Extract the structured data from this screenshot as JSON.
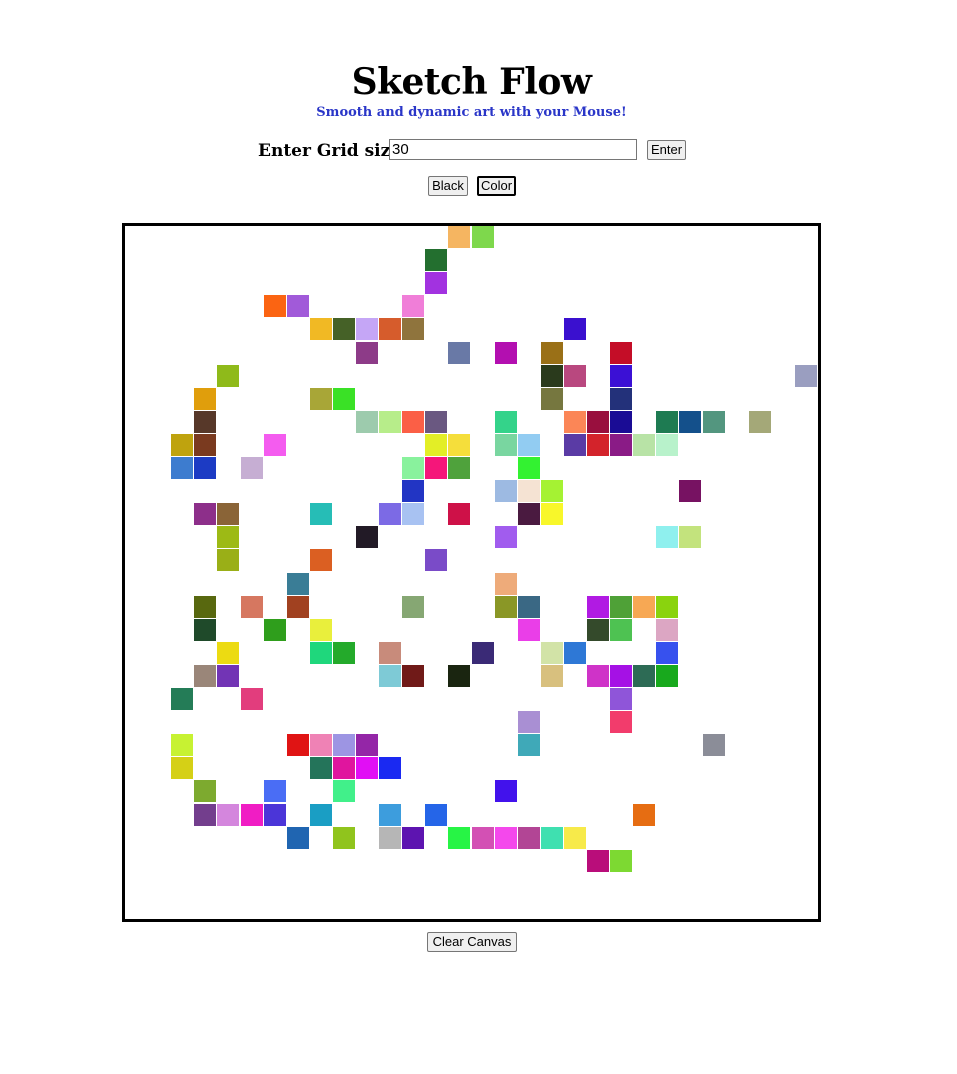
{
  "header": {
    "title": "Sketch Flow",
    "subtitle": "Smooth and dynamic art with your Mouse!"
  },
  "grid_size": {
    "label": "Enter Grid size",
    "value": "30",
    "enter_label": "Enter"
  },
  "mode": {
    "black_label": "Black",
    "color_label": "Color",
    "active": "Color"
  },
  "canvas": {
    "grid_size": 30,
    "background": "#ffffff",
    "painted_cells": [
      {
        "row": 0,
        "col": 14,
        "color": "#f5b561"
      },
      {
        "row": 0,
        "col": 15,
        "color": "#7ed84c"
      },
      {
        "row": 1,
        "col": 13,
        "color": "#236f2f"
      },
      {
        "row": 2,
        "col": 13,
        "color": "#a232e0"
      },
      {
        "row": 3,
        "col": 6,
        "color": "#fb6412"
      },
      {
        "row": 3,
        "col": 7,
        "color": "#a15ad9"
      },
      {
        "row": 3,
        "col": 12,
        "color": "#f07ed8"
      },
      {
        "row": 4,
        "col": 8,
        "color": "#f1b924"
      },
      {
        "row": 4,
        "col": 9,
        "color": "#456127"
      },
      {
        "row": 4,
        "col": 10,
        "color": "#c5a6f6"
      },
      {
        "row": 4,
        "col": 11,
        "color": "#d65c2c"
      },
      {
        "row": 4,
        "col": 12,
        "color": "#8f743d"
      },
      {
        "row": 4,
        "col": 19,
        "color": "#3a10cf"
      },
      {
        "row": 5,
        "col": 10,
        "color": "#8d3b88"
      },
      {
        "row": 5,
        "col": 14,
        "color": "#6979a6"
      },
      {
        "row": 5,
        "col": 16,
        "color": "#b30fb0"
      },
      {
        "row": 5,
        "col": 18,
        "color": "#9a7017"
      },
      {
        "row": 5,
        "col": 21,
        "color": "#c40d27"
      },
      {
        "row": 6,
        "col": 4,
        "color": "#8fba1a"
      },
      {
        "row": 6,
        "col": 18,
        "color": "#2a3a1c"
      },
      {
        "row": 6,
        "col": 19,
        "color": "#b9487f"
      },
      {
        "row": 6,
        "col": 21,
        "color": "#3b10d5"
      },
      {
        "row": 6,
        "col": 29,
        "color": "#9a9ec0"
      },
      {
        "row": 7,
        "col": 3,
        "color": "#e09e0c"
      },
      {
        "row": 7,
        "col": 8,
        "color": "#a8a637"
      },
      {
        "row": 7,
        "col": 9,
        "color": "#3ae126"
      },
      {
        "row": 7,
        "col": 18,
        "color": "#76773f"
      },
      {
        "row": 7,
        "col": 21,
        "color": "#23317a"
      },
      {
        "row": 8,
        "col": 3,
        "color": "#573829"
      },
      {
        "row": 8,
        "col": 10,
        "color": "#9dcbad"
      },
      {
        "row": 8,
        "col": 11,
        "color": "#b7ed8a"
      },
      {
        "row": 8,
        "col": 12,
        "color": "#fb5f46"
      },
      {
        "row": 8,
        "col": 13,
        "color": "#6a5881"
      },
      {
        "row": 8,
        "col": 16,
        "color": "#34d38a"
      },
      {
        "row": 8,
        "col": 19,
        "color": "#fb8657"
      },
      {
        "row": 8,
        "col": 20,
        "color": "#990f3e"
      },
      {
        "row": 8,
        "col": 21,
        "color": "#1a0c95"
      },
      {
        "row": 8,
        "col": 23,
        "color": "#1e7b52"
      },
      {
        "row": 8,
        "col": 24,
        "color": "#14508b"
      },
      {
        "row": 8,
        "col": 25,
        "color": "#53967f"
      },
      {
        "row": 8,
        "col": 27,
        "color": "#a4a878"
      },
      {
        "row": 9,
        "col": 2,
        "color": "#bfa30e"
      },
      {
        "row": 9,
        "col": 3,
        "color": "#7a3a1f"
      },
      {
        "row": 9,
        "col": 6,
        "color": "#f45cef"
      },
      {
        "row": 9,
        "col": 13,
        "color": "#e3ee26"
      },
      {
        "row": 9,
        "col": 14,
        "color": "#f5de3b"
      },
      {
        "row": 9,
        "col": 16,
        "color": "#79d6a0"
      },
      {
        "row": 9,
        "col": 17,
        "color": "#92ccf2"
      },
      {
        "row": 9,
        "col": 19,
        "color": "#5a3ba5"
      },
      {
        "row": 9,
        "col": 20,
        "color": "#d3232b"
      },
      {
        "row": 9,
        "col": 21,
        "color": "#8a1b86"
      },
      {
        "row": 9,
        "col": 22,
        "color": "#b8e3a6"
      },
      {
        "row": 9,
        "col": 23,
        "color": "#b8f2cb"
      },
      {
        "row": 10,
        "col": 2,
        "color": "#3d7ccf"
      },
      {
        "row": 10,
        "col": 3,
        "color": "#1c3bc4"
      },
      {
        "row": 10,
        "col": 5,
        "color": "#c6aed3"
      },
      {
        "row": 10,
        "col": 12,
        "color": "#89f29d"
      },
      {
        "row": 10,
        "col": 13,
        "color": "#f5167a"
      },
      {
        "row": 10,
        "col": 14,
        "color": "#4fa23c"
      },
      {
        "row": 10,
        "col": 17,
        "color": "#33f231"
      },
      {
        "row": 11,
        "col": 12,
        "color": "#2235c4"
      },
      {
        "row": 11,
        "col": 16,
        "color": "#9dbae2"
      },
      {
        "row": 11,
        "col": 17,
        "color": "#f5e3d3"
      },
      {
        "row": 11,
        "col": 18,
        "color": "#a5f233"
      },
      {
        "row": 11,
        "col": 24,
        "color": "#771262"
      },
      {
        "row": 12,
        "col": 3,
        "color": "#8d2f8a"
      },
      {
        "row": 12,
        "col": 4,
        "color": "#8a6437"
      },
      {
        "row": 12,
        "col": 8,
        "color": "#26bdb6"
      },
      {
        "row": 12,
        "col": 11,
        "color": "#7c6ae5"
      },
      {
        "row": 12,
        "col": 12,
        "color": "#a8c2f2"
      },
      {
        "row": 12,
        "col": 14,
        "color": "#ce1148"
      },
      {
        "row": 12,
        "col": 17,
        "color": "#4a1a40"
      },
      {
        "row": 12,
        "col": 18,
        "color": "#f8f72a"
      },
      {
        "row": 13,
        "col": 4,
        "color": "#9dba15"
      },
      {
        "row": 13,
        "col": 10,
        "color": "#221a26"
      },
      {
        "row": 13,
        "col": 16,
        "color": "#a15cee"
      },
      {
        "row": 13,
        "col": 23,
        "color": "#8ff0ee"
      },
      {
        "row": 13,
        "col": 24,
        "color": "#c3e37d"
      },
      {
        "row": 14,
        "col": 4,
        "color": "#9aaf17"
      },
      {
        "row": 14,
        "col": 8,
        "color": "#db5f22"
      },
      {
        "row": 14,
        "col": 13,
        "color": "#7a4bc8"
      },
      {
        "row": 15,
        "col": 7,
        "color": "#3a7d96"
      },
      {
        "row": 15,
        "col": 16,
        "color": "#eeab7a"
      },
      {
        "row": 16,
        "col": 3,
        "color": "#58680f"
      },
      {
        "row": 16,
        "col": 5,
        "color": "#d67760"
      },
      {
        "row": 16,
        "col": 7,
        "color": "#a14120"
      },
      {
        "row": 16,
        "col": 12,
        "color": "#86a773"
      },
      {
        "row": 16,
        "col": 16,
        "color": "#8a9726"
      },
      {
        "row": 16,
        "col": 17,
        "color": "#3a6884"
      },
      {
        "row": 16,
        "col": 20,
        "color": "#b11ae3"
      },
      {
        "row": 16,
        "col": 21,
        "color": "#4fa137"
      },
      {
        "row": 16,
        "col": 22,
        "color": "#f7a854"
      },
      {
        "row": 16,
        "col": 23,
        "color": "#8ad30e"
      },
      {
        "row": 17,
        "col": 3,
        "color": "#1f4a2a"
      },
      {
        "row": 17,
        "col": 6,
        "color": "#2f9e1c"
      },
      {
        "row": 17,
        "col": 8,
        "color": "#e9ef3c"
      },
      {
        "row": 17,
        "col": 17,
        "color": "#ea3ee8"
      },
      {
        "row": 17,
        "col": 20,
        "color": "#344a2b"
      },
      {
        "row": 17,
        "col": 21,
        "color": "#4ec252"
      },
      {
        "row": 17,
        "col": 23,
        "color": "#dca6c3"
      },
      {
        "row": 18,
        "col": 4,
        "color": "#ecdb12"
      },
      {
        "row": 18,
        "col": 8,
        "color": "#1fd77c"
      },
      {
        "row": 18,
        "col": 9,
        "color": "#24aa2b"
      },
      {
        "row": 18,
        "col": 11,
        "color": "#c88b7b"
      },
      {
        "row": 18,
        "col": 15,
        "color": "#3a2a76"
      },
      {
        "row": 18,
        "col": 18,
        "color": "#d2e3a7"
      },
      {
        "row": 18,
        "col": 19,
        "color": "#2e78d6"
      },
      {
        "row": 18,
        "col": 23,
        "color": "#3751ee"
      },
      {
        "row": 19,
        "col": 3,
        "color": "#9a8679"
      },
      {
        "row": 19,
        "col": 4,
        "color": "#7234b5"
      },
      {
        "row": 19,
        "col": 11,
        "color": "#7ecad6"
      },
      {
        "row": 19,
        "col": 12,
        "color": "#701a18"
      },
      {
        "row": 19,
        "col": 14,
        "color": "#1a2510"
      },
      {
        "row": 19,
        "col": 18,
        "color": "#d8c07e"
      },
      {
        "row": 19,
        "col": 20,
        "color": "#cf33c8"
      },
      {
        "row": 19,
        "col": 21,
        "color": "#a511e5"
      },
      {
        "row": 19,
        "col": 22,
        "color": "#2d6b55"
      },
      {
        "row": 19,
        "col": 23,
        "color": "#18a91d"
      },
      {
        "row": 20,
        "col": 2,
        "color": "#247c57"
      },
      {
        "row": 20,
        "col": 5,
        "color": "#e23d7d"
      },
      {
        "row": 20,
        "col": 21,
        "color": "#8f55d9"
      },
      {
        "row": 21,
        "col": 17,
        "color": "#a98fd3"
      },
      {
        "row": 21,
        "col": 21,
        "color": "#f23c6c"
      },
      {
        "row": 22,
        "col": 2,
        "color": "#c7f232"
      },
      {
        "row": 22,
        "col": 7,
        "color": "#e01414"
      },
      {
        "row": 22,
        "col": 8,
        "color": "#ef82b5"
      },
      {
        "row": 22,
        "col": 9,
        "color": "#9d95e3"
      },
      {
        "row": 22,
        "col": 10,
        "color": "#9426a7"
      },
      {
        "row": 22,
        "col": 17,
        "color": "#3fa9b8"
      },
      {
        "row": 22,
        "col": 25,
        "color": "#8b8d98"
      },
      {
        "row": 23,
        "col": 2,
        "color": "#d5d016"
      },
      {
        "row": 23,
        "col": 8,
        "color": "#24745a"
      },
      {
        "row": 23,
        "col": 9,
        "color": "#e0159e"
      },
      {
        "row": 23,
        "col": 10,
        "color": "#e10ef5"
      },
      {
        "row": 23,
        "col": 11,
        "color": "#1a29f2"
      },
      {
        "row": 24,
        "col": 3,
        "color": "#7daa2f"
      },
      {
        "row": 24,
        "col": 6,
        "color": "#4a6df5"
      },
      {
        "row": 24,
        "col": 9,
        "color": "#41f08a"
      },
      {
        "row": 24,
        "col": 16,
        "color": "#4212ec"
      },
      {
        "row": 25,
        "col": 3,
        "color": "#733e8d"
      },
      {
        "row": 25,
        "col": 4,
        "color": "#d486dd"
      },
      {
        "row": 25,
        "col": 5,
        "color": "#f01dc4"
      },
      {
        "row": 25,
        "col": 6,
        "color": "#4b35d8"
      },
      {
        "row": 25,
        "col": 8,
        "color": "#1a9ec4"
      },
      {
        "row": 25,
        "col": 11,
        "color": "#3d9ddd"
      },
      {
        "row": 25,
        "col": 13,
        "color": "#2565e8"
      },
      {
        "row": 25,
        "col": 22,
        "color": "#e66d12"
      },
      {
        "row": 26,
        "col": 7,
        "color": "#2065b1"
      },
      {
        "row": 26,
        "col": 9,
        "color": "#90c41d"
      },
      {
        "row": 26,
        "col": 11,
        "color": "#b6b6b6"
      },
      {
        "row": 26,
        "col": 12,
        "color": "#5d14b0"
      },
      {
        "row": 26,
        "col": 14,
        "color": "#27f445"
      },
      {
        "row": 26,
        "col": 15,
        "color": "#d350b4"
      },
      {
        "row": 26,
        "col": 16,
        "color": "#f448ec"
      },
      {
        "row": 26,
        "col": 17,
        "color": "#b24595"
      },
      {
        "row": 26,
        "col": 18,
        "color": "#3fe0b0"
      },
      {
        "row": 26,
        "col": 19,
        "color": "#f7ea4a"
      },
      {
        "row": 27,
        "col": 20,
        "color": "#b90d7a"
      },
      {
        "row": 27,
        "col": 21,
        "color": "#7dd932"
      }
    ]
  },
  "clear_label": "Clear Canvas"
}
